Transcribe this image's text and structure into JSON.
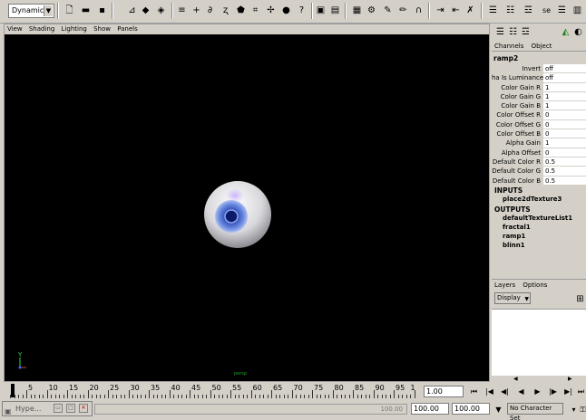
{
  "shelf": {
    "menu_set": "Dynamics",
    "select_label": "se",
    "icons": [
      "open-scene-icon",
      "save-scene-icon",
      "hierarchy-icon",
      "select-object-icon",
      "select-component-icon",
      "lock-icon",
      "snap-grid-icon",
      "snap-curve-icon",
      "snap-point-icon",
      "snap-plane-icon",
      "history-icon",
      "render-icon",
      "ipr-render-icon",
      "render-settings-icon",
      "hypershade-icon",
      "paint-icon",
      "magnet-icon",
      "input-output-icon",
      "attribute-editor-icon",
      "tool-settings-icon",
      "channel-box-icon"
    ]
  },
  "viewport": {
    "menus": [
      "View",
      "Shading",
      "Lighting",
      "Show",
      "Panels"
    ],
    "axis_label": "Y",
    "camera_label": "persp"
  },
  "channel_box": {
    "tabs": [
      "Channels",
      "Object"
    ],
    "node": "ramp2",
    "attributes": [
      {
        "label": "Invert",
        "value": "off"
      },
      {
        "label": "ha Is Luminance",
        "value": "off"
      },
      {
        "label": "Color Gain R",
        "value": "1"
      },
      {
        "label": "Color Gain G",
        "value": "1"
      },
      {
        "label": "Color Gain B",
        "value": "1"
      },
      {
        "label": "Color Offset R",
        "value": "0"
      },
      {
        "label": "Color Offset G",
        "value": "0"
      },
      {
        "label": "Color Offset B",
        "value": "0"
      },
      {
        "label": "Alpha Gain",
        "value": "1"
      },
      {
        "label": "Alpha Offset",
        "value": "0"
      },
      {
        "label": "Default Color R",
        "value": "0.5"
      },
      {
        "label": "Default Color G",
        "value": "0.5"
      },
      {
        "label": "Default Color B",
        "value": "0.5"
      }
    ],
    "inputs_header": "INPUTS",
    "inputs": [
      "place2dTexture3"
    ],
    "outputs_header": "OUTPUTS",
    "outputs": [
      "defaultTextureList1",
      "fractal1",
      "ramp1",
      "blinn1"
    ]
  },
  "layers": {
    "tabs": [
      "Layers",
      "Options"
    ],
    "display_option": "Display"
  },
  "time_slider": {
    "ticks": [
      "5",
      "10",
      "15",
      "20",
      "25",
      "30",
      "35",
      "40",
      "45",
      "50",
      "55",
      "60",
      "65",
      "70",
      "75",
      "80",
      "85",
      "90",
      "95",
      "1"
    ],
    "current_frame": "1.00"
  },
  "range": {
    "minimized_window": "Hype...",
    "range_end_label": "100.00",
    "start": "100.00",
    "end": "100.00",
    "character_set": "No Character Set"
  }
}
